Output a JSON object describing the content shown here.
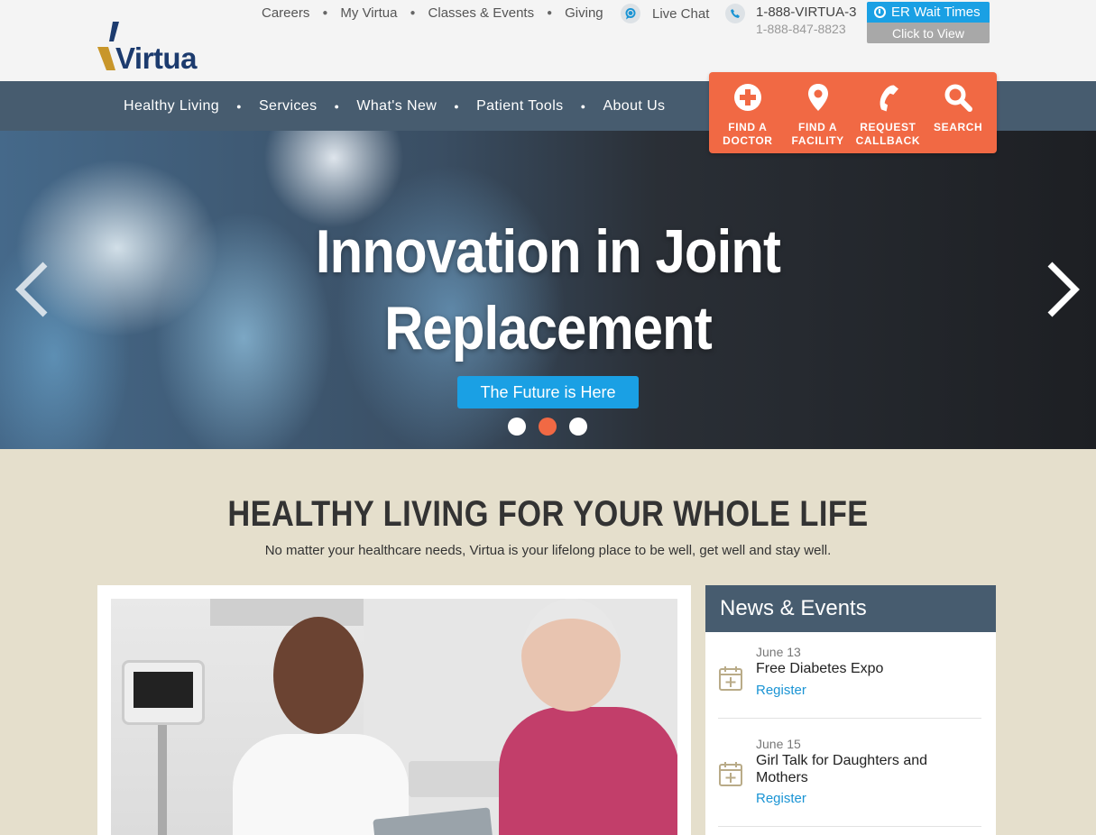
{
  "brand": {
    "logo_text": "Virtua",
    "accent_blue": "#1aa0e4",
    "accent_orange": "#f16944",
    "nav_color": "#475c6f",
    "logo_gold": "#c8962a",
    "logo_navy": "#1c3b6e"
  },
  "utility": {
    "links": [
      "Careers",
      "My Virtua",
      "Classes & Events",
      "Giving"
    ],
    "chat_icon": "chat-bubble-icon",
    "chat_label": "Live Chat",
    "phone_icon": "phone-icon",
    "phone_main": "1-888-VIRTUA-3",
    "phone_alt": "1-888-847-8823",
    "er_label": "ER Wait Times",
    "er_action": "Click to View"
  },
  "nav": {
    "items": [
      "Healthy Living",
      "Services",
      "What's New",
      "Patient Tools",
      "About Us"
    ]
  },
  "quick_actions": [
    {
      "label": "FIND A\nDOCTOR",
      "icon": "medical-cross-icon"
    },
    {
      "label": "FIND A\nFACILITY",
      "icon": "map-pin-icon"
    },
    {
      "label": "REQUEST\nCALLBACK",
      "icon": "phone-icon"
    },
    {
      "label": "SEARCH",
      "icon": "search-icon"
    }
  ],
  "hero": {
    "title_line1": "Innovation in Joint",
    "title_line2": "Replacement",
    "cta": "The Future is Here",
    "slides_count": 3,
    "active_slide": 2,
    "prev_icon": "chevron-left-icon",
    "next_icon": "chevron-right-icon"
  },
  "section": {
    "title": "HEALTHY LIVING FOR YOUR WHOLE LIFE",
    "subtitle": "No matter your healthcare needs, Virtua is your lifelong place to be well, get well and stay well."
  },
  "news": {
    "heading": "News & Events",
    "items": [
      {
        "date": "June 13",
        "title": "Free Diabetes Expo",
        "link": "Register",
        "icon": "calendar-plus-icon"
      },
      {
        "date": "June 15",
        "title": "Girl Talk for Daughters and Mothers",
        "link": "Register",
        "icon": "calendar-plus-icon"
      }
    ]
  }
}
